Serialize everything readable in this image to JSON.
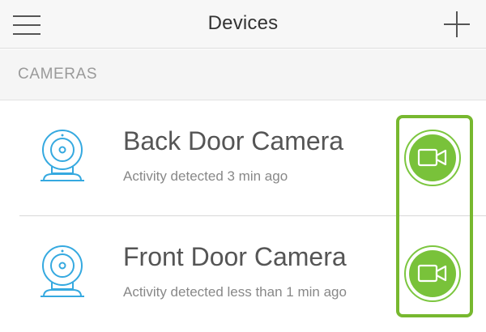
{
  "header": {
    "title": "Devices",
    "menu_icon": "hamburger-menu-icon",
    "add_icon": "plus-icon"
  },
  "section": {
    "label": "CAMERAS"
  },
  "devices": [
    {
      "name": "Back Door Camera",
      "status": "Activity detected 3 min ago",
      "icon": "camera-device-icon",
      "action_icon": "video-camera-icon"
    },
    {
      "name": "Front Door Camera",
      "status": "Activity detected less than 1 min ago",
      "icon": "camera-device-icon",
      "action_icon": "video-camera-icon"
    }
  ],
  "colors": {
    "accent": "#79c23a",
    "highlight": "#77b82f",
    "camera_icon": "#35a9e0"
  }
}
